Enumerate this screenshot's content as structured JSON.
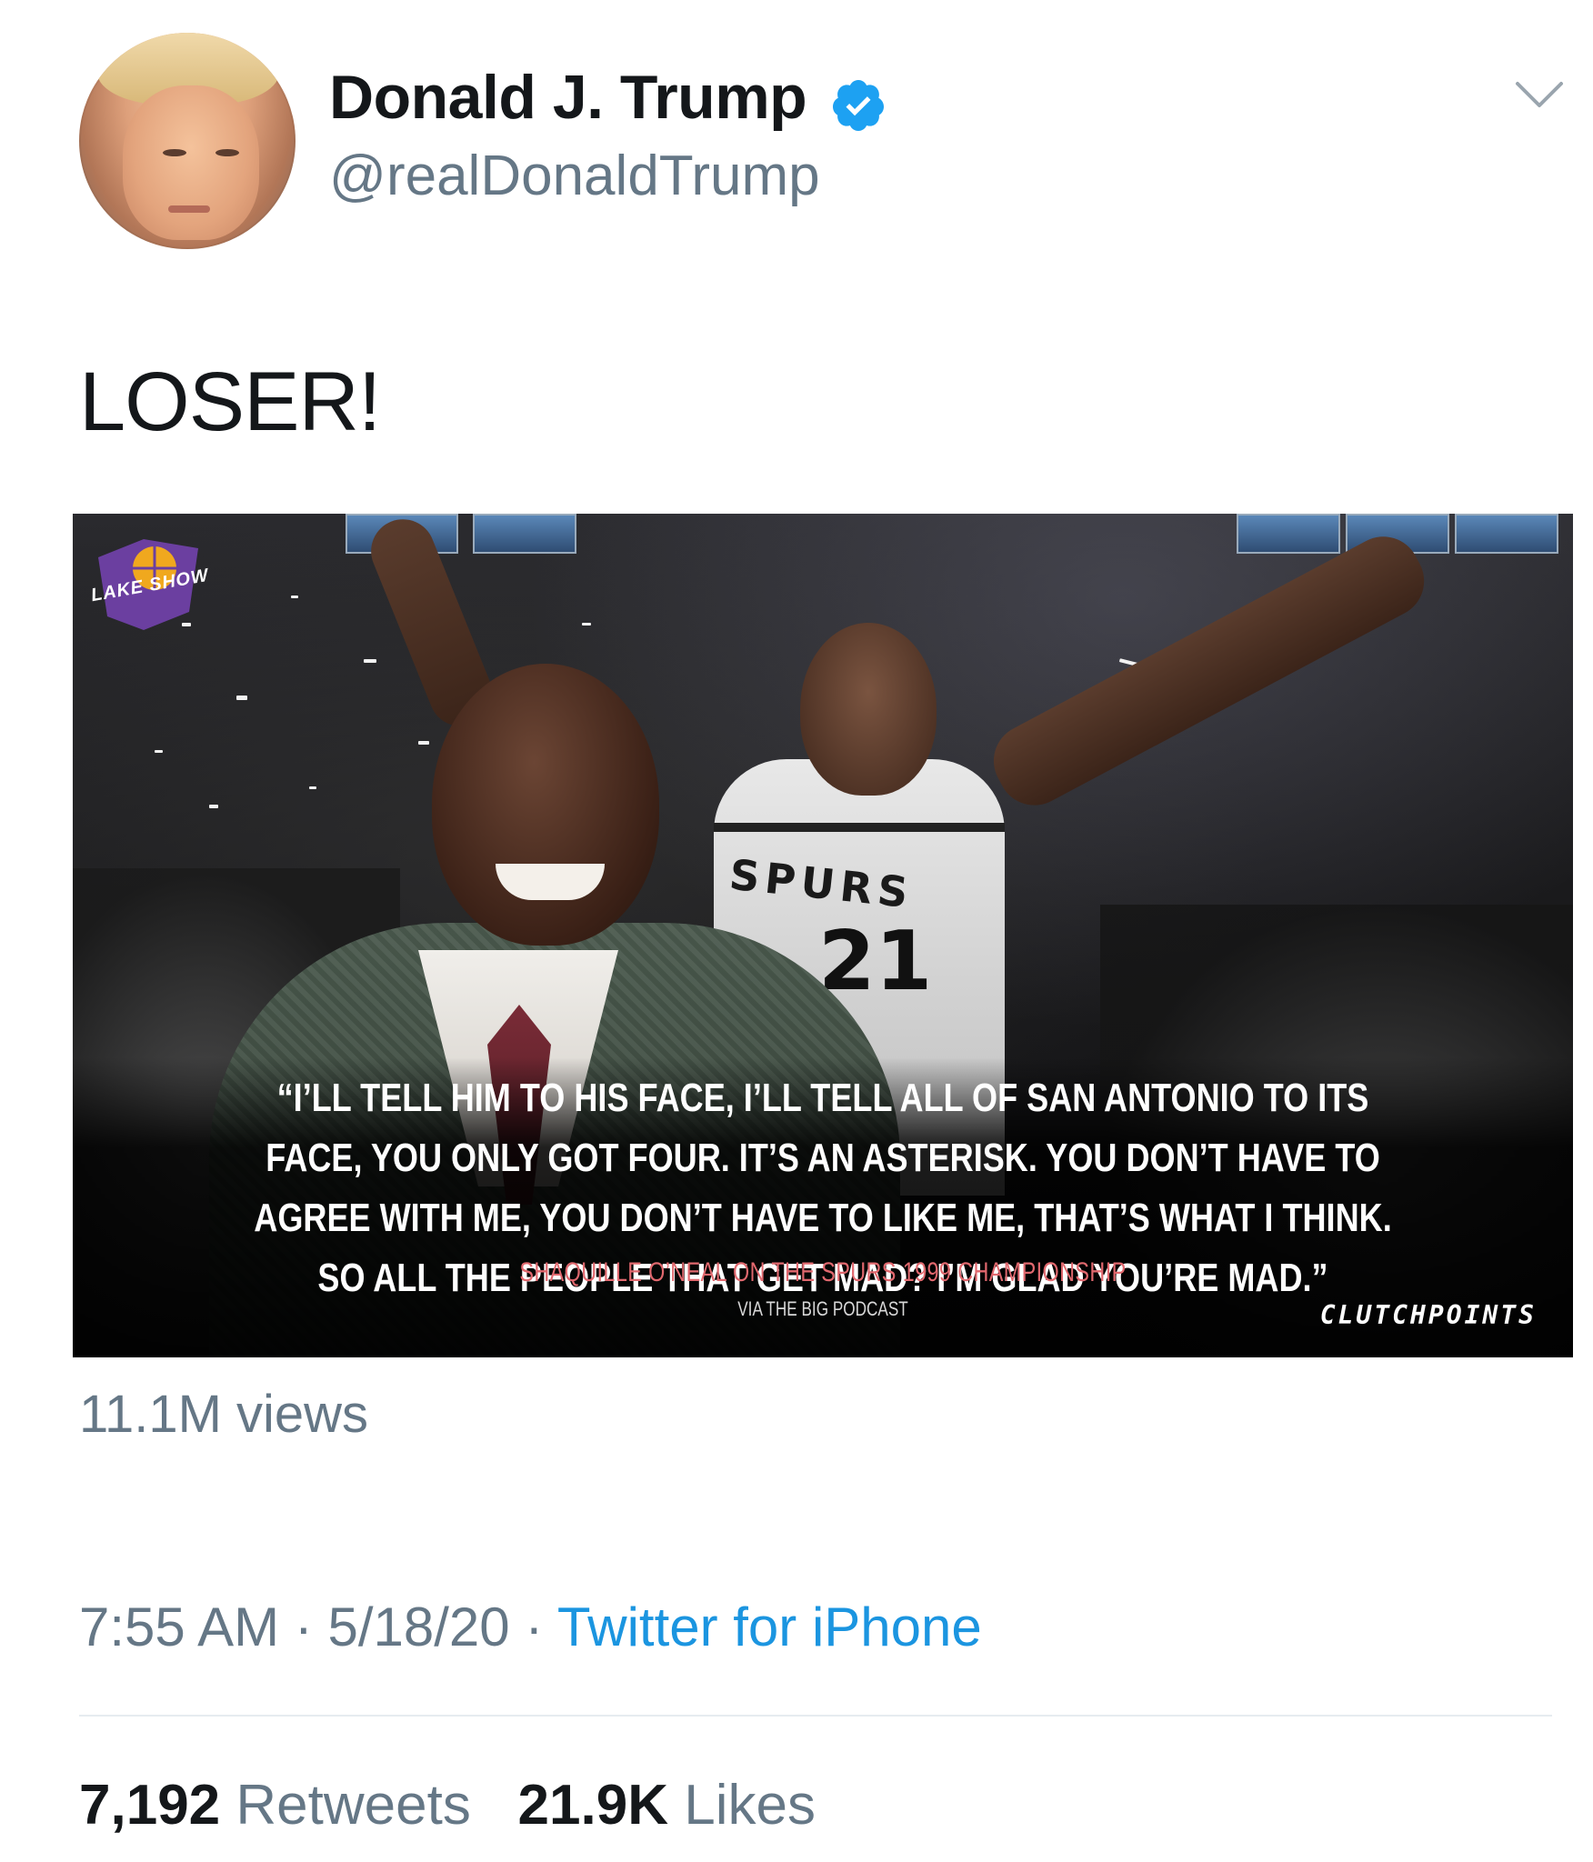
{
  "tweet": {
    "display_name": "Donald J. Trump",
    "handle": "@realDonaldTrump",
    "verified": true,
    "text": "LOSER!",
    "views": "11.1M views",
    "time": "7:55 AM",
    "date": "5/18/20",
    "source": "Twitter for iPhone",
    "separator": "·",
    "retweets_count": "7,192",
    "retweets_label": "Retweets",
    "likes_count": "21.9K",
    "likes_label": "Likes"
  },
  "media": {
    "quote": "“I’LL TELL HIM TO HIS FACE, I’LL TELL ALL OF SAN ANTONIO TO ITS FACE, YOU ONLY GOT FOUR. IT’S AN ASTERISK. YOU DON’T HAVE TO AGREE WITH ME, YOU DON’T HAVE TO LIKE ME, THAT’S WHAT I THINK. SO ALL THE PEOPLE THAT GET MAD? I’M GLAD YOU’RE MAD.”",
    "attribution": "SHAQUILLE O’NEAL ON THE SPURS 1999 CHAMPIONSHIP",
    "source": "VIA THE BIG PODCAST",
    "logo_left": "LAKE SHOW",
    "logo_right": "CLUTCHPOINTS",
    "jersey_text": "SPURS",
    "jersey_number": "21"
  },
  "colors": {
    "text_primary": "#14171a",
    "text_secondary": "#657786",
    "link": "#1b95e0",
    "verified": "#1da1f2",
    "quote_accent": "#e0686e"
  },
  "icons": {
    "verified": "verified-badge-icon",
    "menu": "chevron-down-icon"
  }
}
